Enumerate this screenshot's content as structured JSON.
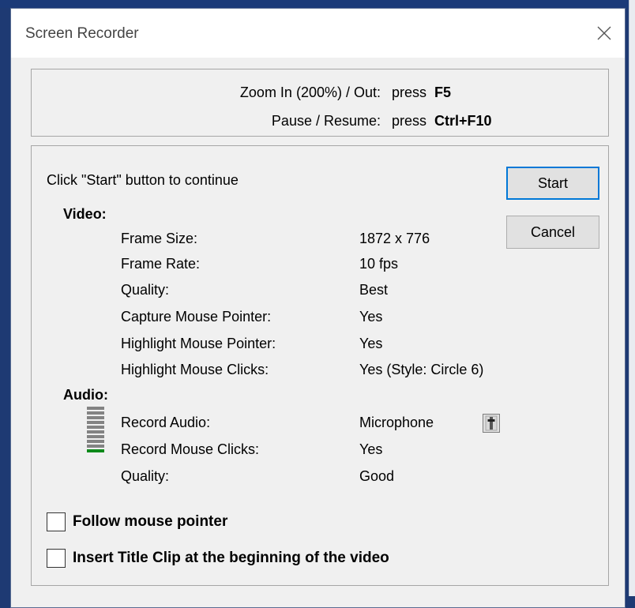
{
  "window": {
    "title": "Screen Recorder"
  },
  "shortcuts": [
    {
      "label": "Zoom In (200%) / Out:",
      "press": "press",
      "key": "F5"
    },
    {
      "label": "Pause / Resume:",
      "press": "press",
      "key": "Ctrl+F10"
    }
  ],
  "instruction": "Click \"Start\" button to continue",
  "buttons": {
    "start": "Start",
    "cancel": "Cancel"
  },
  "video": {
    "heading": "Video:",
    "rows": [
      {
        "label": "Frame Size:",
        "value": "1872 x 776"
      },
      {
        "label": "Frame Rate:",
        "value": "10 fps"
      },
      {
        "label": "Quality:",
        "value": "Best"
      },
      {
        "label": "Capture Mouse Pointer:",
        "value": "Yes"
      },
      {
        "label": "Highlight Mouse Pointer:",
        "value": "Yes"
      },
      {
        "label": "Highlight Mouse Clicks:",
        "value": "Yes (Style: Circle 6)"
      }
    ]
  },
  "audio": {
    "heading": "Audio:",
    "rows": [
      {
        "label": "Record Audio:",
        "value": "Microphone"
      },
      {
        "label": "Record Mouse Clicks:",
        "value": "Yes"
      },
      {
        "label": "Quality:",
        "value": "Good"
      }
    ],
    "level_meter": {
      "segments": 10,
      "active": 1,
      "active_color": "#0e8a1a"
    }
  },
  "options": {
    "follow_mouse": {
      "label": "Follow mouse pointer",
      "checked": false
    },
    "title_clip": {
      "label": "Insert Title Clip at the beginning of the video",
      "checked": false
    }
  },
  "icons": {
    "close": "close-icon",
    "mic_settings": "microphone-settings-icon"
  }
}
